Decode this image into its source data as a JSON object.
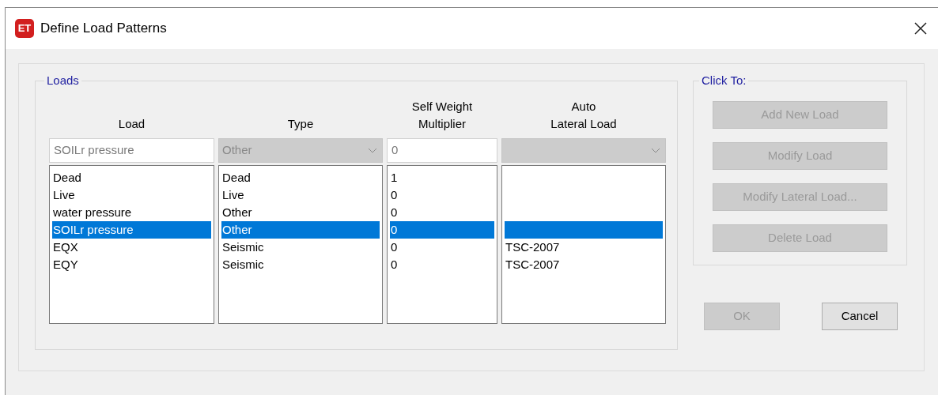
{
  "window": {
    "app_badge": "ET",
    "title": "Define Load Patterns"
  },
  "loads": {
    "title": "Loads",
    "columns": [
      {
        "lines": [
          "Load"
        ]
      },
      {
        "lines": [
          "Type"
        ]
      },
      {
        "lines": [
          "Self Weight",
          "Multiplier"
        ]
      },
      {
        "lines": [
          "Auto",
          "Lateral Load"
        ]
      }
    ],
    "edit_fields": [
      {
        "kind": "text",
        "value": "SOILr pressure"
      },
      {
        "kind": "dropdown",
        "value": "Other"
      },
      {
        "kind": "text",
        "value": "0"
      },
      {
        "kind": "dropdown"
      }
    ],
    "rows": [
      {
        "load": "Dead",
        "type": "Dead",
        "multiplier": "1",
        "selected": false
      },
      {
        "load": "Live",
        "type": "Live",
        "multiplier": "0",
        "selected": false
      },
      {
        "load": "water pressure",
        "type": "Other",
        "multiplier": "0",
        "selected": false
      },
      {
        "load": "SOILr pressure",
        "type": "Other",
        "multiplier": "0",
        "selected": true
      },
      {
        "load": "EQX",
        "type": "Seismic",
        "multiplier": "0",
        "auto_lateral_load": "TSC-2007",
        "selected": false
      },
      {
        "load": "EQY",
        "type": "Seismic",
        "multiplier": "0",
        "auto_lateral_load": "TSC-2007",
        "selected": false
      }
    ]
  },
  "click_to": {
    "title": "Click To:",
    "buttons": [
      {
        "label": "Add New Load",
        "disabled": true
      },
      {
        "label": "Modify Load",
        "disabled": true
      },
      {
        "label": "Modify Lateral Load...",
        "disabled": true
      },
      {
        "label": "Delete Load",
        "disabled": true
      }
    ]
  },
  "dialog_buttons": [
    {
      "label": "OK",
      "disabled": true
    },
    {
      "label": "Cancel",
      "disabled": false
    }
  ]
}
